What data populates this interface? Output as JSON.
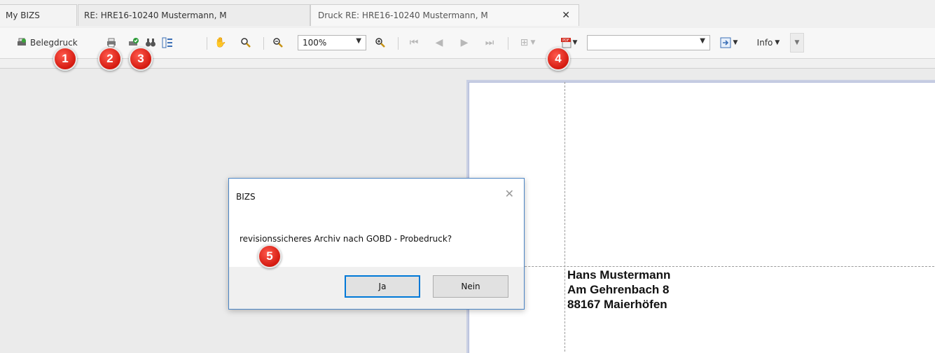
{
  "tabs": [
    {
      "label": "My BIZS"
    },
    {
      "label": "RE: HRE16-10240 Mustermann, M"
    },
    {
      "label": "Druck RE: HRE16-10240 Mustermann, M",
      "close": "✕"
    }
  ],
  "toolbar": {
    "belegdruck_label": "Belegdruck",
    "zoom_value": "100%",
    "export_combo_value": "",
    "info_label": "Info"
  },
  "document": {
    "address_lines": [
      "Hans Mustermann",
      "Am Gehrenbach 8",
      "88167 Maierhöfen"
    ]
  },
  "dialog": {
    "title": "BIZS",
    "message": "revisionssicheres Archiv nach GOBD - Probedruck?",
    "yes_label": "Ja",
    "no_label": "Nein"
  },
  "markers": [
    "1",
    "2",
    "3",
    "4",
    "5"
  ],
  "colors": {
    "marker_red": "#e0271c",
    "dialog_border": "#4a84c4",
    "focus_blue": "#0078d7"
  }
}
